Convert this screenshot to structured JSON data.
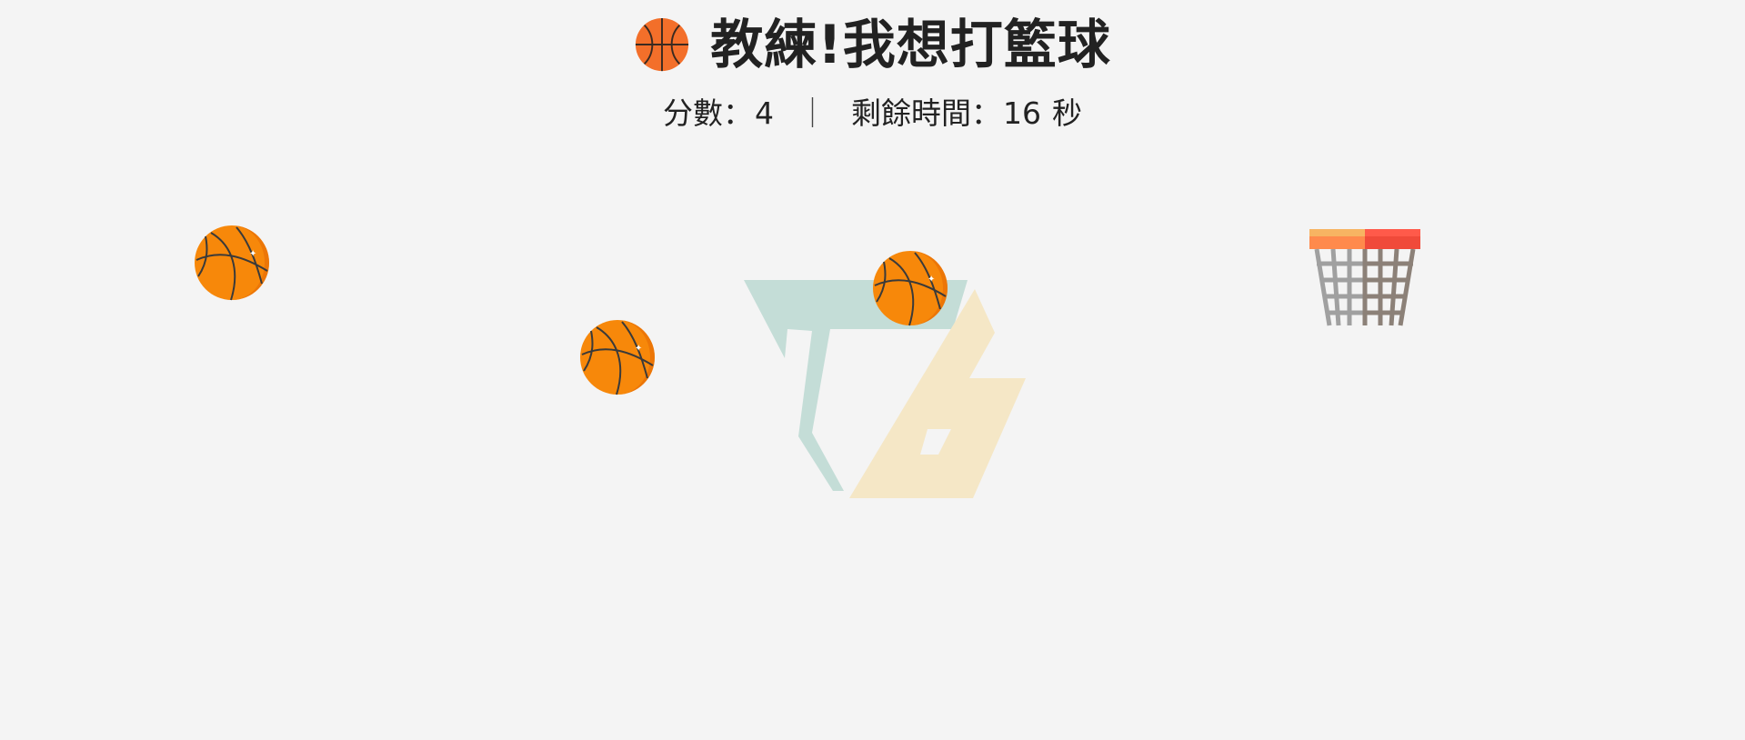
{
  "header": {
    "title": "教練!我想打籃球",
    "title_icon": "basketball-icon"
  },
  "hud": {
    "score_label": "分數：",
    "score": "4",
    "separator": "｜",
    "time_label": "剩餘時間：",
    "time": "16",
    "time_unit": "秒"
  },
  "game": {
    "balls": [
      "basketball-icon",
      "basketball-icon",
      "basketball-icon"
    ],
    "hoop": "basketball-hoop-icon",
    "watermark": "tb-logo-watermark"
  },
  "colors": {
    "background": "#f4f4f4",
    "ball_orange": "#f7880a",
    "ball_line": "#3a3a3a",
    "rim_orange": "#ff8a4c",
    "rim_red": "#f04a3a",
    "net_gray": "#9a9a9a",
    "logo_teal": "#c4ddd7",
    "logo_cream": "#f5e7c6"
  }
}
